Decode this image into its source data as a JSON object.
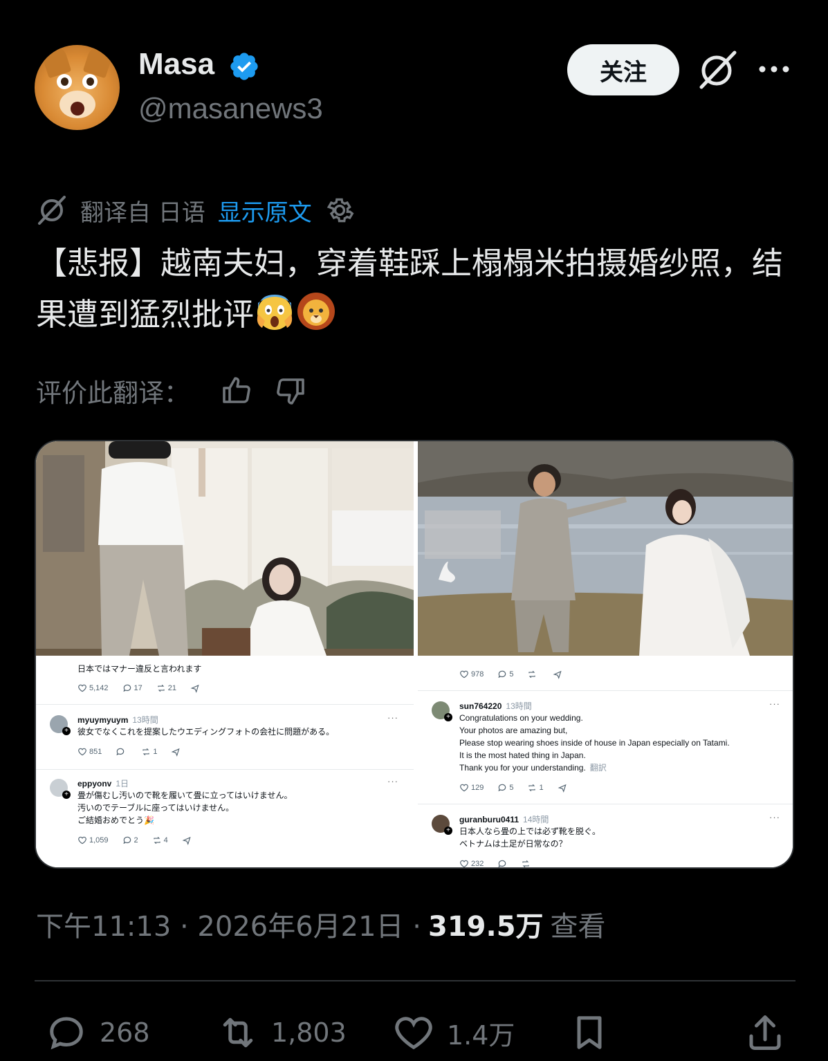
{
  "author": {
    "name": "Masa",
    "handle": "@masanews3",
    "verified": true
  },
  "header": {
    "follow_label": "关注",
    "grok_icon": "grok-icon",
    "more_icon": "more-icon"
  },
  "translation": {
    "label": "翻译自 日语",
    "show_original": "显示原文"
  },
  "tweet": {
    "text": "【悲报】越南夫妇，穿着鞋踩上榻榻米拍摄婚纱照，结果遭到猛烈批评"
  },
  "rating": {
    "label": "评价此翻译："
  },
  "media": {
    "left": {
      "top_comment": "日本ではマナー違反と言われます",
      "top_stats": [
        "5,142",
        "17",
        "21"
      ],
      "comments": [
        {
          "user": "myuymyuym",
          "time": "13時間",
          "lines": [
            "彼女でなくこれを提案したウエディングフォトの会社に問題がある。"
          ],
          "stats": [
            "851",
            "",
            "1"
          ]
        },
        {
          "user": "eppyonv",
          "time": "1日",
          "lines": [
            "畳が傷むし汚いので靴を履いて畳に立ってはいけません。",
            "汚いのでテーブルに座ってはいけません。",
            "ご結婚おめでとう🎉"
          ],
          "stats": [
            "1,059",
            "2",
            "4"
          ]
        }
      ]
    },
    "right": {
      "top_stats": [
        "978",
        "5",
        ""
      ],
      "comments": [
        {
          "user": "sun764220",
          "time": "13時間",
          "lines": [
            "Congratulations on your wedding.",
            "Your photos are amazing but,",
            "Please stop wearing shoes inside of house in Japan especially on Tatami.",
            "It is the most hated thing in Japan.",
            "Thank you for your understanding."
          ],
          "translate": "翻訳",
          "stats": [
            "129",
            "5",
            "1"
          ]
        },
        {
          "user": "guranburu0411",
          "time": "14時間",
          "lines": [
            "日本人なら畳の上では必ず靴を脱ぐ。",
            "ベトナムは土足が日常なの？"
          ],
          "stats": [
            "232",
            "",
            ""
          ]
        }
      ]
    }
  },
  "meta": {
    "time": "下午11:13 · 2026年6月21日 · ",
    "views": "319.5万",
    "views_label": "查看"
  },
  "actions": {
    "replies": "268",
    "reposts": "1,803",
    "likes": "1.4万"
  },
  "colors": {
    "background": "#000000",
    "text": "#e7e9ea",
    "muted": "#71767b",
    "link": "#1d9bf0",
    "verified": "#1d9bf0"
  }
}
